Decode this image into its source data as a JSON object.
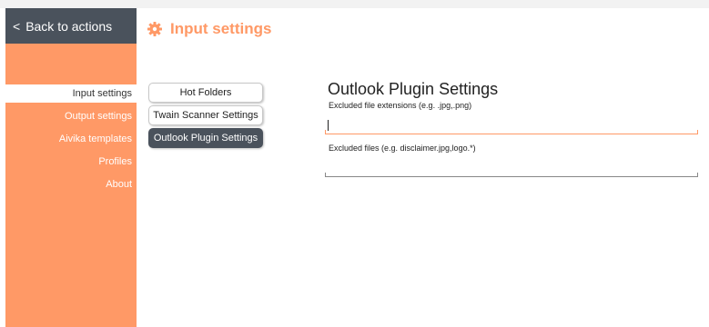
{
  "sidebar": {
    "back_label": "Back to actions",
    "items": [
      {
        "label": "Input settings",
        "active": true
      },
      {
        "label": "Output settings",
        "active": false
      },
      {
        "label": "Aivika templates",
        "active": false
      },
      {
        "label": "Profiles",
        "active": false
      },
      {
        "label": "About",
        "active": false
      }
    ]
  },
  "header": {
    "icon": "gear-icon",
    "title": "Input settings"
  },
  "subnav": {
    "buttons": [
      {
        "label": "Hot Folders",
        "selected": false
      },
      {
        "label": "Twain Scanner Settings",
        "selected": false
      },
      {
        "label": "Outlook Plugin Settings",
        "selected": true
      }
    ]
  },
  "content": {
    "title": "Outlook Plugin Settings",
    "fields": [
      {
        "label": "Excluded file extensions (e.g. .jpg,.png)",
        "value": "",
        "focused": true
      },
      {
        "label": "Excluded files (e.g. disclaimer.jpg,logo.*)",
        "value": "",
        "focused": false
      }
    ]
  },
  "colors": {
    "accent": "#ff9966",
    "dark": "#4a525c"
  }
}
